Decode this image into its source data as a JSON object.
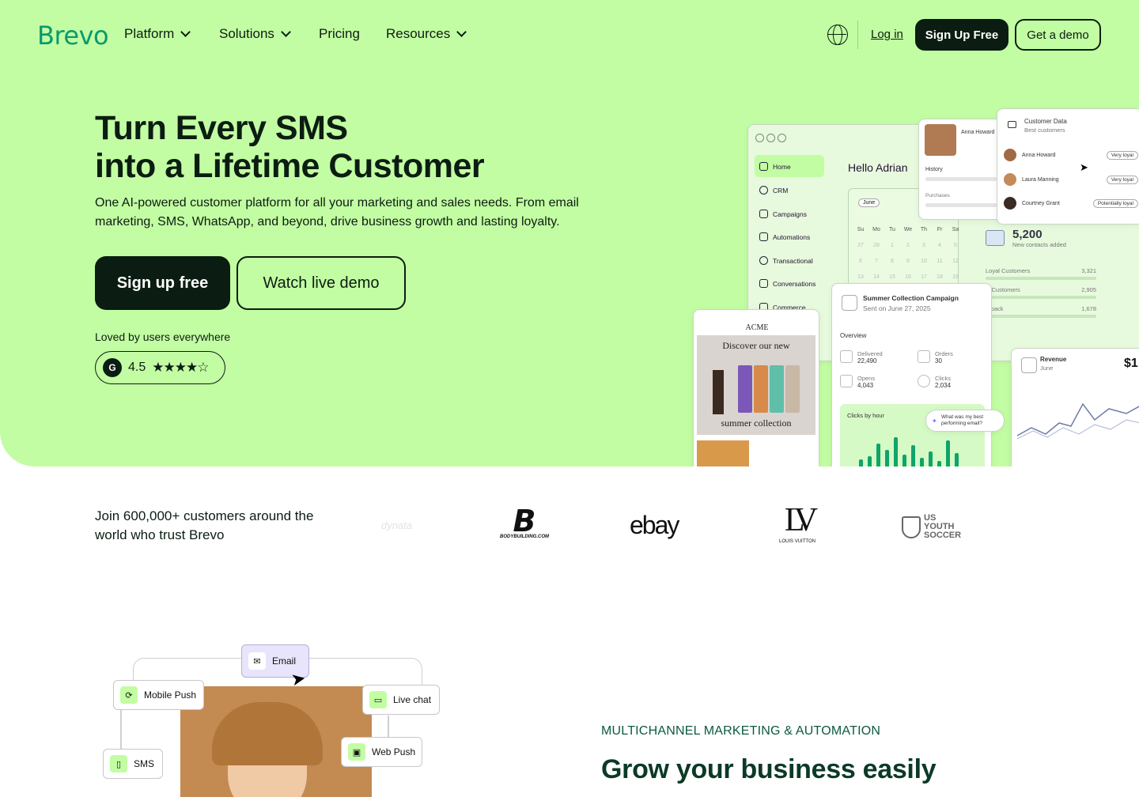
{
  "nav": {
    "logo": "Brevo",
    "items": [
      {
        "label": "Platform",
        "dropdown": true
      },
      {
        "label": "Solutions",
        "dropdown": true
      },
      {
        "label": "Pricing",
        "dropdown": false
      },
      {
        "label": "Resources",
        "dropdown": true
      }
    ],
    "login": "Log in",
    "signup": "Sign Up Free",
    "demo": "Get a demo"
  },
  "hero": {
    "title_line1": "Turn Every SMS",
    "title_line2": "into a Lifetime Customer",
    "subtitle": "One AI-powered customer platform for all your marketing and sales needs. From email marketing, SMS, WhatsApp, and beyond, drive business growth and lasting loyalty.",
    "cta_primary": "Sign up free",
    "cta_secondary": "Watch live demo",
    "loved": "Loved by users everywhere",
    "rating": "4.5",
    "rating_badge": "G",
    "stars": "★★★★☆"
  },
  "mockup": {
    "greeting": "Hello Adrian",
    "sidebar": [
      "Home",
      "CRM",
      "Campaigns",
      "Automations",
      "Transactional",
      "Conversations",
      "Commerce"
    ],
    "calendar_month": "June",
    "weekdays": [
      "Su",
      "Mo",
      "Tu",
      "We",
      "Th",
      "Fr",
      "Sa"
    ],
    "contact_name": "Anna Howard",
    "contact_history": "History",
    "contact_purchases": "Purchases",
    "customer_data_title": "Customer Data",
    "customer_data_sub": "Best customers",
    "customers": [
      {
        "name": "Anna Howard",
        "tag": "Very loyal"
      },
      {
        "name": "Laura Manning",
        "tag": "Very loyal"
      },
      {
        "name": "Courtney Grant",
        "tag": "Potentially loyal"
      }
    ],
    "contacts_count": "5,200",
    "contacts_label": "New contacts added",
    "segments": [
      {
        "label": "Loyal Customers",
        "value": "3,321"
      },
      {
        "label": "w Customers",
        "value": "2,905"
      },
      {
        "label": "n-back",
        "value": "1,678"
      }
    ],
    "campaign_title": "Summer Collection Campaign",
    "campaign_date": "Sent on June 27, 2025",
    "overview": "Overview",
    "stats": [
      {
        "label": "Delivered",
        "value": "22,490"
      },
      {
        "label": "Orders",
        "value": "30"
      },
      {
        "label": "Opens",
        "value": "4,043"
      },
      {
        "label": "Clicks",
        "value": "2,034"
      }
    ],
    "clicks_by_hour": "Clicks by hour",
    "ai_prompt": "What was my best performing email?",
    "email_brand": "ACME",
    "email_headline1": "Discover our new",
    "email_headline2": "summer collection",
    "revenue_title": "Revenue",
    "revenue_month": "June",
    "revenue_value": "$1"
  },
  "trust": {
    "text": "Join 600,000+ customers around the world who trust Brevo",
    "brands": [
      "dynata",
      "BODYBUILDING.COM",
      "ebay",
      "LOUIS VUITTON",
      "US YOUTH SOCCER"
    ]
  },
  "section2": {
    "channels": [
      "Email",
      "Mobile Push",
      "Live chat",
      "SMS",
      "Web Push"
    ],
    "eyebrow": "MULTICHANNEL MARKETING & AUTOMATION",
    "title": "Grow your business easily"
  },
  "colors": {
    "hero_bg": "#c3fda3",
    "brand_green": "#0b996e",
    "dark": "#0b1d12"
  }
}
